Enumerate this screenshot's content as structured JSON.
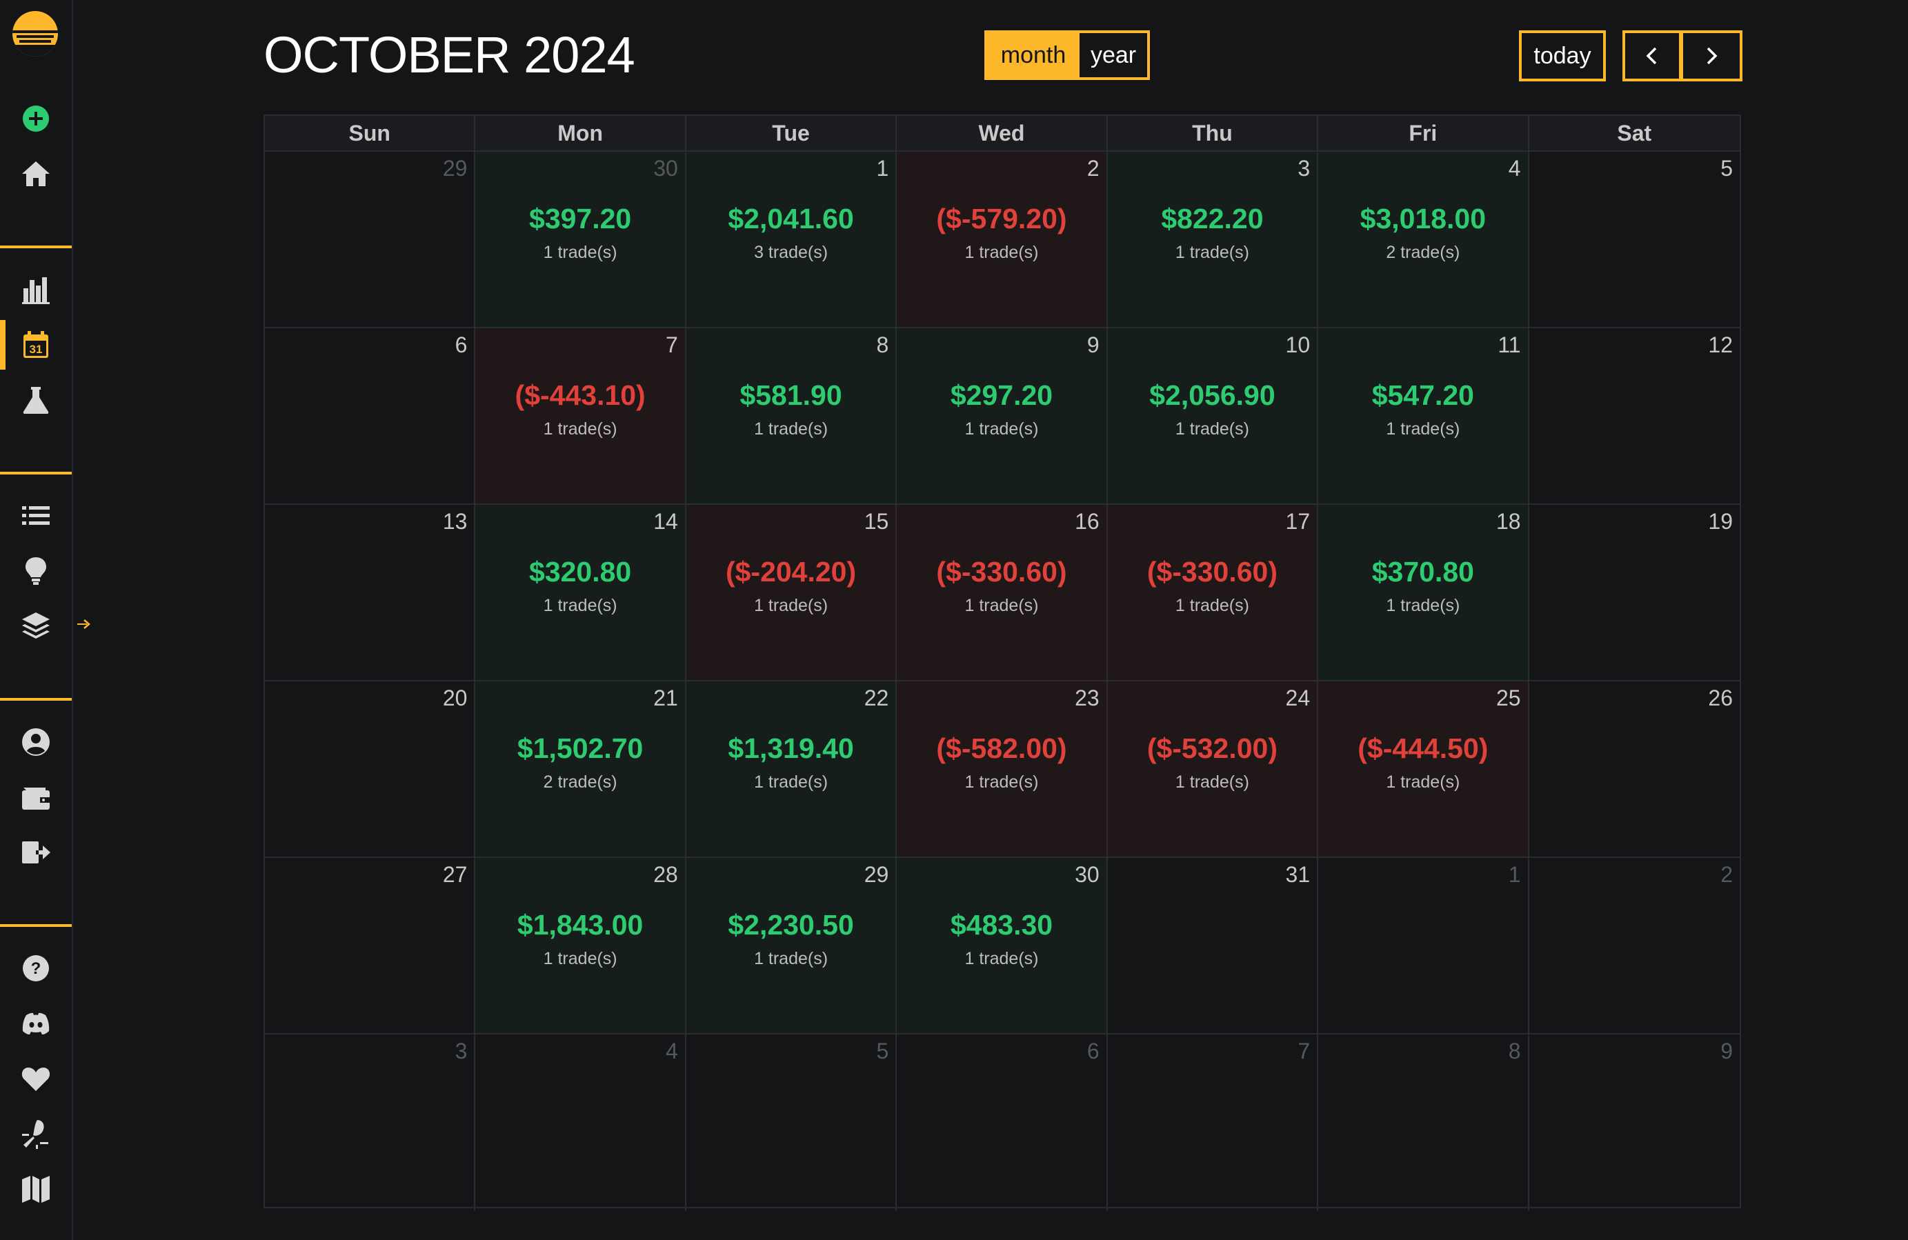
{
  "header": {
    "title": "OCTOBER 2024",
    "view_month": "month",
    "view_year": "year",
    "today": "today"
  },
  "sidebar": {
    "icons": [
      "logo-icon",
      "add-icon",
      "home-icon",
      "bar-chart-icon",
      "calendar-icon",
      "flask-icon",
      "list-icon",
      "lightbulb-icon",
      "layers-icon",
      "user-icon",
      "wallet-icon",
      "logout-icon",
      "help-icon",
      "discord-icon",
      "heart-icon",
      "feedback-icon",
      "map-icon"
    ],
    "calendar_icon_text": "31",
    "accent": "#fcb72b",
    "active_item": "calendar"
  },
  "colors": {
    "profit": "#2ecc71",
    "loss": "#e0413a",
    "accent": "#fcb72b",
    "background": "#141517"
  },
  "weekdays": [
    "Sun",
    "Mon",
    "Tue",
    "Wed",
    "Thu",
    "Fri",
    "Sat"
  ],
  "weeks": [
    [
      {
        "day": "29",
        "other": true
      },
      {
        "day": "30",
        "other": true,
        "pnl": "$397.20",
        "trades": "1 trade(s)",
        "result": "win"
      },
      {
        "day": "1",
        "pnl": "$2,041.60",
        "trades": "3 trade(s)",
        "result": "win"
      },
      {
        "day": "2",
        "pnl": "($-579.20)",
        "trades": "1 trade(s)",
        "result": "loss"
      },
      {
        "day": "3",
        "pnl": "$822.20",
        "trades": "1 trade(s)",
        "result": "win"
      },
      {
        "day": "4",
        "pnl": "$3,018.00",
        "trades": "2 trade(s)",
        "result": "win"
      },
      {
        "day": "5"
      }
    ],
    [
      {
        "day": "6"
      },
      {
        "day": "7",
        "pnl": "($-443.10)",
        "trades": "1 trade(s)",
        "result": "loss"
      },
      {
        "day": "8",
        "pnl": "$581.90",
        "trades": "1 trade(s)",
        "result": "win"
      },
      {
        "day": "9",
        "pnl": "$297.20",
        "trades": "1 trade(s)",
        "result": "win"
      },
      {
        "day": "10",
        "pnl": "$2,056.90",
        "trades": "1 trade(s)",
        "result": "win"
      },
      {
        "day": "11",
        "pnl": "$547.20",
        "trades": "1 trade(s)",
        "result": "win"
      },
      {
        "day": "12"
      }
    ],
    [
      {
        "day": "13"
      },
      {
        "day": "14",
        "pnl": "$320.80",
        "trades": "1 trade(s)",
        "result": "win"
      },
      {
        "day": "15",
        "pnl": "($-204.20)",
        "trades": "1 trade(s)",
        "result": "loss"
      },
      {
        "day": "16",
        "pnl": "($-330.60)",
        "trades": "1 trade(s)",
        "result": "loss"
      },
      {
        "day": "17",
        "pnl": "($-330.60)",
        "trades": "1 trade(s)",
        "result": "loss"
      },
      {
        "day": "18",
        "pnl": "$370.80",
        "trades": "1 trade(s)",
        "result": "win"
      },
      {
        "day": "19"
      }
    ],
    [
      {
        "day": "20"
      },
      {
        "day": "21",
        "pnl": "$1,502.70",
        "trades": "2 trade(s)",
        "result": "win"
      },
      {
        "day": "22",
        "pnl": "$1,319.40",
        "trades": "1 trade(s)",
        "result": "win"
      },
      {
        "day": "23",
        "pnl": "($-582.00)",
        "trades": "1 trade(s)",
        "result": "loss"
      },
      {
        "day": "24",
        "pnl": "($-532.00)",
        "trades": "1 trade(s)",
        "result": "loss"
      },
      {
        "day": "25",
        "pnl": "($-444.50)",
        "trades": "1 trade(s)",
        "result": "loss"
      },
      {
        "day": "26"
      }
    ],
    [
      {
        "day": "27"
      },
      {
        "day": "28",
        "pnl": "$1,843.00",
        "trades": "1 trade(s)",
        "result": "win"
      },
      {
        "day": "29",
        "pnl": "$2,230.50",
        "trades": "1 trade(s)",
        "result": "win"
      },
      {
        "day": "30",
        "pnl": "$483.30",
        "trades": "1 trade(s)",
        "result": "win"
      },
      {
        "day": "31"
      },
      {
        "day": "1",
        "other": true
      },
      {
        "day": "2",
        "other": true
      }
    ],
    [
      {
        "day": "3",
        "other": true
      },
      {
        "day": "4",
        "other": true
      },
      {
        "day": "5",
        "other": true
      },
      {
        "day": "6",
        "other": true
      },
      {
        "day": "7",
        "other": true
      },
      {
        "day": "8",
        "other": true
      },
      {
        "day": "9",
        "other": true
      }
    ]
  ]
}
